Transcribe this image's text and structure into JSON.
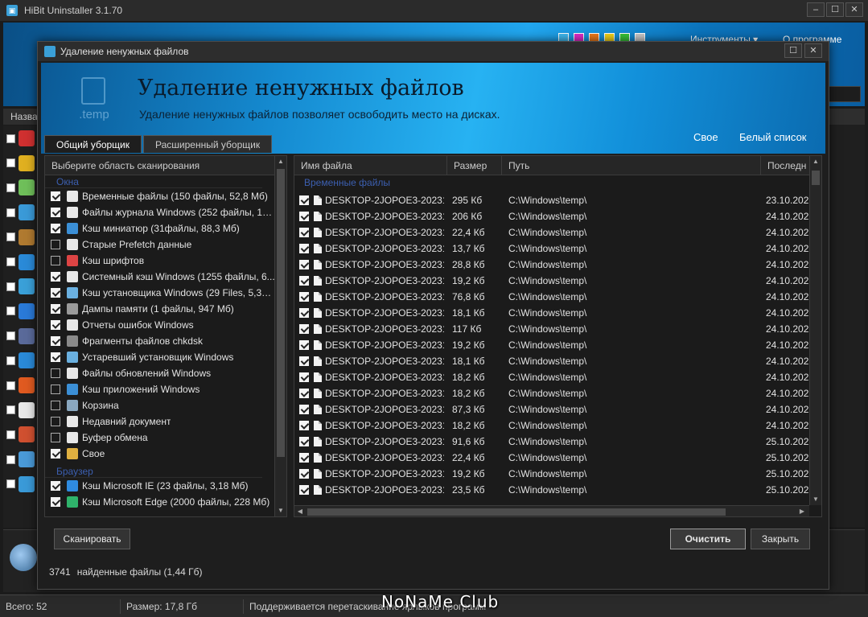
{
  "main_window": {
    "title": "HiBit Uninstaller 3.1.70",
    "menu": {
      "tools": "Инструменты ▾",
      "about": "О программе"
    },
    "theme_colors": [
      "#3fb9f0",
      "#e02cc8",
      "#ef7a1a",
      "#f2d21b",
      "#38c43a",
      "#c9c9c9"
    ],
    "list_header": "Назва",
    "statusbar": {
      "total": "Всего: 52",
      "size": "Размер: 17,8 Гб",
      "hint": "Поддерживается перетаскивание ярлыков программ"
    },
    "watermark": "NoNaMe Club"
  },
  "dialog": {
    "title": "Удаление ненужных файлов",
    "banner": {
      "icon_text": ".temp",
      "title": "Удаление ненужных файлов",
      "subtitle": "Удаление ненужных файлов позволяет освободить место на дисках.",
      "link_custom": "Свое",
      "link_whitelist": "Белый список"
    },
    "tabs": [
      {
        "label": "Общий уборщик",
        "active": true
      },
      {
        "label": "Расширенный уборщик",
        "active": false
      }
    ],
    "left_pane": {
      "header": "Выберите область сканирования",
      "groups": [
        {
          "label": "Окна",
          "items": [
            {
              "label": "Временные файлы (150 файлы, 52,8 Мб)",
              "checked": true,
              "icon": "temp-file-icon",
              "color": "#e8e8e8"
            },
            {
              "label": "Файлы журнала Windows (252 файлы, 147...",
              "checked": true,
              "icon": "log-file-icon",
              "color": "#e8e8e8"
            },
            {
              "label": "Кэш миниатюр (31файлы, 88,3 Мб)",
              "checked": true,
              "icon": "thumbnail-icon",
              "color": "#3b8fd6"
            },
            {
              "label": "Старые Prefetch данные",
              "checked": false,
              "icon": "prefetch-icon",
              "color": "#e8e8e8"
            },
            {
              "label": "Кэш шрифтов",
              "checked": false,
              "icon": "font-icon",
              "color": "#d44"
            },
            {
              "label": "Системный кэш Windows (1255 файлы, 6...",
              "checked": true,
              "icon": "system-cache-icon",
              "color": "#e8e8e8"
            },
            {
              "label": "Кэш установщика Windows (29 Files, 5,38 ...",
              "checked": true,
              "icon": "installer-icon",
              "color": "#6ab0e0"
            },
            {
              "label": "Дампы памяти (1 файлы, 947 Мб)",
              "checked": true,
              "icon": "memory-dump-icon",
              "color": "#9a9a9a"
            },
            {
              "label": "Отчеты ошибок Windows",
              "checked": true,
              "icon": "error-report-icon",
              "color": "#e8e8e8"
            },
            {
              "label": "Фрагменты файлов chkdsk",
              "checked": true,
              "icon": "chkdsk-icon",
              "color": "#8a8a8a"
            },
            {
              "label": "Устаревший установщик Windows",
              "checked": true,
              "icon": "old-installer-icon",
              "color": "#6ab0e0"
            },
            {
              "label": "Файлы обновлений Windows",
              "checked": false,
              "icon": "update-icon",
              "color": "#e8e8e8"
            },
            {
              "label": "Кэш приложений Windows",
              "checked": false,
              "icon": "app-cache-gear-icon",
              "color": "#3b8fd6"
            },
            {
              "label": "Корзина",
              "checked": false,
              "icon": "recycle-bin-icon",
              "color": "#8aa8c0"
            },
            {
              "label": "Недавний документ",
              "checked": false,
              "icon": "recent-doc-icon",
              "color": "#e8e8e8"
            },
            {
              "label": "Буфер обмена",
              "checked": false,
              "icon": "clipboard-icon",
              "color": "#e8e8e8"
            },
            {
              "label": "Свое",
              "checked": true,
              "icon": "custom-folder-icon",
              "color": "#e0b040"
            }
          ]
        },
        {
          "label": "Браузер",
          "items": [
            {
              "label": "Кэш Microsoft IE (23 файлы, 3,18 Мб)",
              "checked": true,
              "icon": "ie-icon",
              "color": "#2f8be0"
            },
            {
              "label": "Кэш Microsoft Edge (2000 файлы, 228 Мб)",
              "checked": true,
              "icon": "edge-icon",
              "color": "#2fb36b"
            }
          ]
        }
      ]
    },
    "table": {
      "columns": [
        "Имя файла",
        "Размер",
        "Путь",
        "Последн"
      ],
      "group": "Временные файлы",
      "rows": [
        {
          "name": "DESKTOP-2JOPOE3-20231...",
          "size": "295 Кб",
          "path": "C:\\Windows\\temp\\",
          "date": "23.10.202"
        },
        {
          "name": "DESKTOP-2JOPOE3-20231...",
          "size": "206 Кб",
          "path": "C:\\Windows\\temp\\",
          "date": "24.10.202"
        },
        {
          "name": "DESKTOP-2JOPOE3-20231...",
          "size": "22,4 Кб",
          "path": "C:\\Windows\\temp\\",
          "date": "24.10.202"
        },
        {
          "name": "DESKTOP-2JOPOE3-20231...",
          "size": "13,7 Кб",
          "path": "C:\\Windows\\temp\\",
          "date": "24.10.202"
        },
        {
          "name": "DESKTOP-2JOPOE3-20231...",
          "size": "28,8 Кб",
          "path": "C:\\Windows\\temp\\",
          "date": "24.10.202"
        },
        {
          "name": "DESKTOP-2JOPOE3-20231...",
          "size": "19,2 Кб",
          "path": "C:\\Windows\\temp\\",
          "date": "24.10.202"
        },
        {
          "name": "DESKTOP-2JOPOE3-20231...",
          "size": "76,8 Кб",
          "path": "C:\\Windows\\temp\\",
          "date": "24.10.202"
        },
        {
          "name": "DESKTOP-2JOPOE3-20231...",
          "size": "18,1 Кб",
          "path": "C:\\Windows\\temp\\",
          "date": "24.10.202"
        },
        {
          "name": "DESKTOP-2JOPOE3-20231...",
          "size": "117 Кб",
          "path": "C:\\Windows\\temp\\",
          "date": "24.10.202"
        },
        {
          "name": "DESKTOP-2JOPOE3-20231...",
          "size": "19,2 Кб",
          "path": "C:\\Windows\\temp\\",
          "date": "24.10.202"
        },
        {
          "name": "DESKTOP-2JOPOE3-20231...",
          "size": "18,1 Кб",
          "path": "C:\\Windows\\temp\\",
          "date": "24.10.202"
        },
        {
          "name": "DESKTOP-2JOPOE3-20231...",
          "size": "18,2 Кб",
          "path": "C:\\Windows\\temp\\",
          "date": "24.10.202"
        },
        {
          "name": "DESKTOP-2JOPOE3-20231...",
          "size": "18,2 Кб",
          "path": "C:\\Windows\\temp\\",
          "date": "24.10.202"
        },
        {
          "name": "DESKTOP-2JOPOE3-20231...",
          "size": "87,3 Кб",
          "path": "C:\\Windows\\temp\\",
          "date": "24.10.202"
        },
        {
          "name": "DESKTOP-2JOPOE3-20231...",
          "size": "18,2 Кб",
          "path": "C:\\Windows\\temp\\",
          "date": "24.10.202"
        },
        {
          "name": "DESKTOP-2JOPOE3-20231...",
          "size": "91,6 Кб",
          "path": "C:\\Windows\\temp\\",
          "date": "25.10.202"
        },
        {
          "name": "DESKTOP-2JOPOE3-20231...",
          "size": "22,4 Кб",
          "path": "C:\\Windows\\temp\\",
          "date": "25.10.202"
        },
        {
          "name": "DESKTOP-2JOPOE3-20231...",
          "size": "19,2 Кб",
          "path": "C:\\Windows\\temp\\",
          "date": "25.10.202"
        },
        {
          "name": "DESKTOP-2JOPOE3-20231...",
          "size": "23,5 Кб",
          "path": "C:\\Windows\\temp\\",
          "date": "25.10.202"
        }
      ]
    },
    "buttons": {
      "scan": "Сканировать",
      "clean": "Очистить",
      "close": "Закрыть"
    },
    "found": {
      "count": "3741",
      "text": "найденные файлы (1,44 Гб)"
    }
  }
}
